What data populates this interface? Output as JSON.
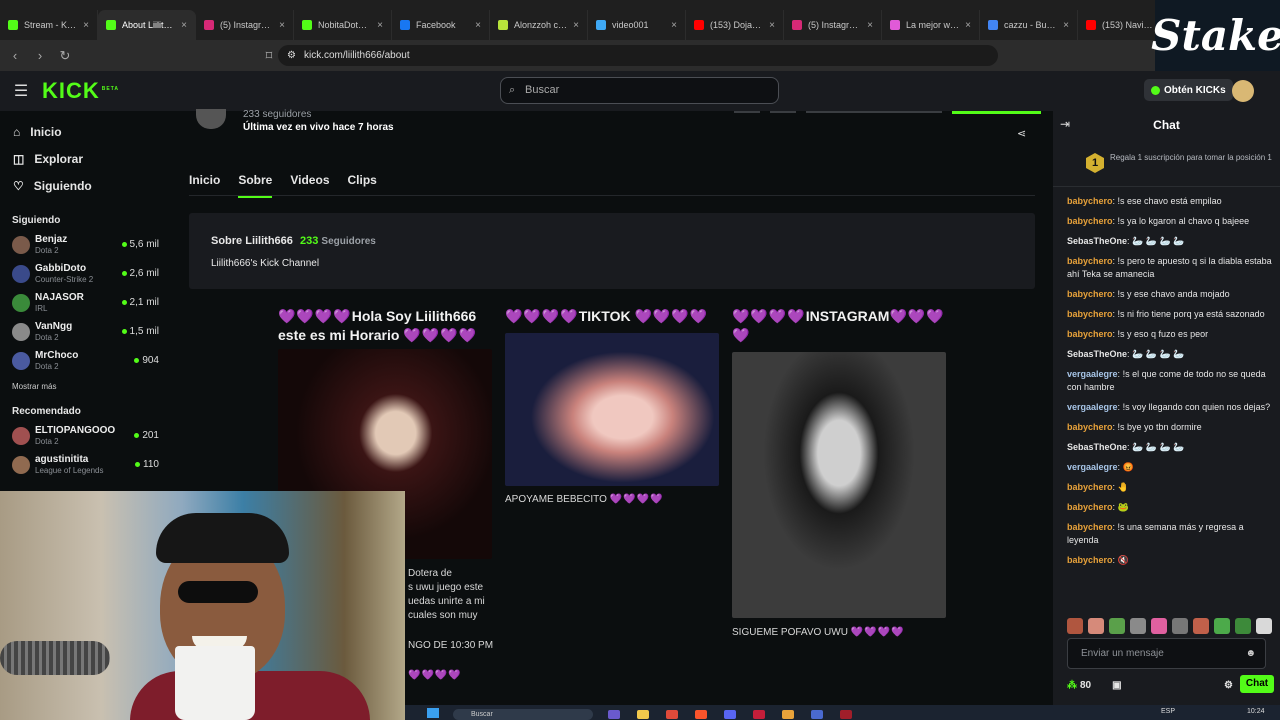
{
  "browser": {
    "tabs": [
      {
        "title": "Stream - Kick",
        "color": "#53fc18"
      },
      {
        "title": "About Liilith666",
        "color": "#53fc18",
        "active": true
      },
      {
        "title": "(5) Instagram",
        "color": "#d62976"
      },
      {
        "title": "NobitaDoto S...",
        "color": "#53fc18"
      },
      {
        "title": "Facebook",
        "color": "#1877f2"
      },
      {
        "title": "Alonzzoh clipped",
        "color": "#b7e33b"
      },
      {
        "title": "video001",
        "color": "#3fa9f5"
      },
      {
        "title": "(153) Doja Cat - S...",
        "color": "#ff0000"
      },
      {
        "title": "(5) Instagram",
        "color": "#d62976"
      },
      {
        "title": "La mejor web/app",
        "color": "#e05ad8"
      },
      {
        "title": "cazzu - Buscar co...",
        "color": "#4285f4"
      },
      {
        "title": "(153) Navidad de...",
        "color": "#ff0000"
      }
    ],
    "url": "kick.com/liilith666/about",
    "overlay_logo": "Stake"
  },
  "header": {
    "logo": "KICK",
    "logo_badge": "BETA",
    "search_placeholder": "Buscar",
    "kicks_button": "Obtén KICKs"
  },
  "sidebar": {
    "nav": [
      {
        "label": "Inicio",
        "icon": "home-icon"
      },
      {
        "label": "Explorar",
        "icon": "compass-icon"
      },
      {
        "label": "Siguiendo",
        "icon": "heart-icon"
      }
    ],
    "following_title": "Siguiendo",
    "following": [
      {
        "name": "Benjaz",
        "game": "Dota 2",
        "viewers": "5,6 mil",
        "color": "#7a5a4a"
      },
      {
        "name": "GabbiDoto",
        "game": "Counter-Strike 2",
        "viewers": "2,6 mil",
        "color": "#3a4a8a"
      },
      {
        "name": "NAJASOR",
        "game": "IRL",
        "viewers": "2,1 mil",
        "color": "#3a8a3a"
      },
      {
        "name": "VanNgg",
        "game": "Dota 2",
        "viewers": "1,5 mil",
        "color": "#8a8a8a"
      },
      {
        "name": "MrChoco",
        "game": "Dota 2",
        "viewers": "904",
        "color": "#4a5aa0"
      }
    ],
    "show_more": "Mostrar más",
    "recommended_title": "Recomendado",
    "recommended": [
      {
        "name": "ELTIOPANGOOO",
        "game": "Dota 2",
        "viewers": "201",
        "color": "#a05050"
      },
      {
        "name": "agustinitita",
        "game": "League of Legends",
        "viewers": "110",
        "color": "#906a50"
      }
    ]
  },
  "profile": {
    "followers": "233 seguidores",
    "last_live": "Última vez en vivo hace 7 horas",
    "tabs": [
      "Inicio",
      "Sobre",
      "Videos",
      "Clips"
    ],
    "active_tab": "Sobre",
    "about_title": "Sobre Liilith666",
    "about_count": "233",
    "about_count_label": "Seguidores",
    "about_desc": "Liilith666's Kick Channel"
  },
  "panels": [
    {
      "hearts_pre": "💜💜💜💜",
      "title": "Hola Soy Liilith666 este es mi Horario",
      "hearts_post": "💜💜💜💜",
      "caption_lines": [
        "Dotera de",
        "s uwu juego este",
        "uedas unirte a mi",
        "cuales son muy",
        "",
        "NGO DE 10:30 PM",
        "",
        "💜💜💜💜"
      ]
    },
    {
      "hearts_pre": "💜💜💜💜",
      "title": "TIKTOK",
      "hearts_post": "💜💜💜💜",
      "caption": "APOYAME BEBECITO",
      "caption_hearts": "💜💜💜💜"
    },
    {
      "hearts_pre": "💜💜💜💜",
      "title": "INSTAGRAM",
      "hearts_post": "💜💜💜💜",
      "caption": "SIGUEME POFAVO UWU",
      "caption_hearts": "💜💜💜💜"
    }
  ],
  "chat": {
    "title": "Chat",
    "pinned_rank": "1",
    "pinned_text": "Regala 1 suscripción para tomar la posición 1",
    "messages": [
      {
        "user": "babychero",
        "color": "#e8a23a",
        "text": "!s ese chavo está empilao"
      },
      {
        "user": "babychero",
        "color": "#e8a23a",
        "text": "!s ya lo kgaron al chavo q bajeee"
      },
      {
        "user": "SebasTheOne",
        "color": "#e6e6e6",
        "text": "🦢 🦢 🦢 🦢"
      },
      {
        "user": "babychero",
        "color": "#e8a23a",
        "text": "!s pero te apuesto q si la diabla estaba ahí Teka se amanecia"
      },
      {
        "user": "babychero",
        "color": "#e8a23a",
        "text": "!s y ese chavo anda mojado"
      },
      {
        "user": "babychero",
        "color": "#e8a23a",
        "text": "!s ni frio tiene porq ya está sazonado"
      },
      {
        "user": "babychero",
        "color": "#e8a23a",
        "text": "!s y eso q fuzo es peor"
      },
      {
        "user": "SebasTheOne",
        "color": "#e6e6e6",
        "text": "🦢 🦢 🦢 🦢"
      },
      {
        "user": "vergaalegre",
        "color": "#a8c6e8",
        "text": "!s el que come de todo no se queda con hambre"
      },
      {
        "user": "vergaalegre",
        "color": "#a8c6e8",
        "text": "!s voy llegando con quien nos dejas?"
      },
      {
        "user": "babychero",
        "color": "#e8a23a",
        "text": "!s bye yo tbn dormire"
      },
      {
        "user": "SebasTheOne",
        "color": "#e6e6e6",
        "text": "🦢 🦢 🦢 🦢"
      },
      {
        "user": "vergaalegre",
        "color": "#a8c6e8",
        "text": "😡"
      },
      {
        "user": "babychero",
        "color": "#e8a23a",
        "text": "🤚"
      },
      {
        "user": "babychero",
        "color": "#e8a23a",
        "text": "🐸"
      },
      {
        "user": "babychero",
        "color": "#e8a23a",
        "text": "!s una semana más y regresa a leyenda"
      },
      {
        "user": "babychero",
        "color": "#e8a23a",
        "text": "🔇"
      }
    ],
    "input_placeholder": "Enviar un mensaje",
    "points": "80",
    "send_label": "Chat"
  },
  "taskbar": {
    "search": "Buscar",
    "lang": "ESP",
    "time": "10:24"
  }
}
